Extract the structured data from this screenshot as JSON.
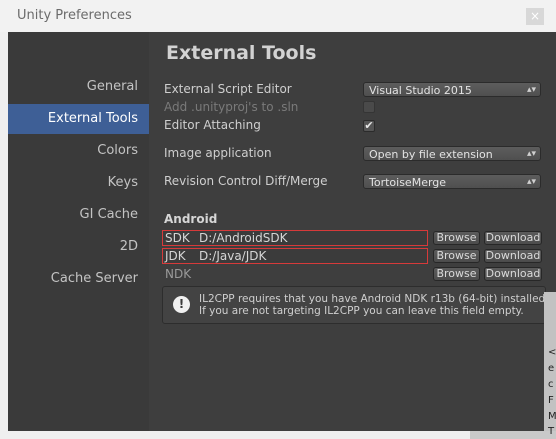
{
  "window": {
    "title": "Unity Preferences",
    "close_glyph": "×"
  },
  "sidebar": {
    "items": [
      {
        "label": "General"
      },
      {
        "label": "External Tools",
        "active": true
      },
      {
        "label": "Colors"
      },
      {
        "label": "Keys"
      },
      {
        "label": "GI Cache"
      },
      {
        "label": "2D"
      },
      {
        "label": "Cache Server"
      }
    ]
  },
  "main": {
    "title": "External Tools",
    "script_editor": {
      "label": "External Script Editor",
      "value": "Visual Studio 2015"
    },
    "add_unityproj": {
      "label": "Add .unityproj's to .sln",
      "checked": false,
      "disabled": true
    },
    "editor_attaching": {
      "label": "Editor Attaching",
      "checked": true,
      "check_glyph": "✔"
    },
    "image_application": {
      "label": "Image application",
      "value": "Open by file extension"
    },
    "revision_control": {
      "label": "Revision Control Diff/Merge",
      "value": "TortoiseMerge"
    },
    "android": {
      "heading": "Android",
      "sdk": {
        "label": "SDK",
        "path": "D:/AndroidSDK"
      },
      "jdk": {
        "label": "JDK",
        "path": "D:/Java/JDK"
      },
      "ndk": {
        "label": "NDK",
        "path": ""
      },
      "browse_label": "Browse",
      "download_label": "Download"
    },
    "help": {
      "icon": "!",
      "line1": "IL2CPP requires that you have Android NDK r13b (64-bit) installed.",
      "line2": "If you are not targeting IL2CPP you can leave this field empty."
    }
  },
  "colors": {
    "accent": "#3e5f96",
    "highlight_border": "#d63a3a"
  },
  "background_editor": {
    "chars": [
      "<",
      "e",
      "c",
      "F",
      "M",
      "T"
    ]
  }
}
